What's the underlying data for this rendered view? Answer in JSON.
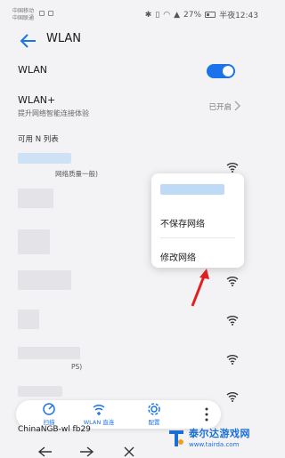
{
  "status_bar": {
    "carrier_1": "中国移动",
    "carrier_2": "中国联通",
    "battery": "27%",
    "time": "半夜12:43"
  },
  "header": {
    "title": "WLAN"
  },
  "wlan_toggle": {
    "label": "WLAN",
    "enabled": true
  },
  "wlan_plus": {
    "label": "WLAN+",
    "subtitle": "提升网络智能连接体验",
    "value": "已开启"
  },
  "available_section": {
    "label": "可用 N 列表"
  },
  "networks": [
    {
      "name": "",
      "status": "网络质量一般)"
    },
    {
      "name": "",
      "status": ""
    },
    {
      "name": "",
      "status": ""
    },
    {
      "name": "",
      "status": ""
    },
    {
      "name": "",
      "status": ""
    },
    {
      "name": "",
      "status": "PS)"
    },
    {
      "name": "",
      "status": ""
    }
  ],
  "context_menu": {
    "items": [
      "不保存网络",
      "修改网络"
    ]
  },
  "toolbar": {
    "scan_label": "扫描",
    "direct_label": "WLAN 直连",
    "config_label": "配置"
  },
  "partial_network": "ChinaNGB-wl fb29",
  "watermark": {
    "title": "泰尔达游戏网",
    "url": "www.tairda.com"
  },
  "colors": {
    "accent": "#1a73e8",
    "arrow": "#e02020",
    "watermark": "#1a6fd6"
  }
}
